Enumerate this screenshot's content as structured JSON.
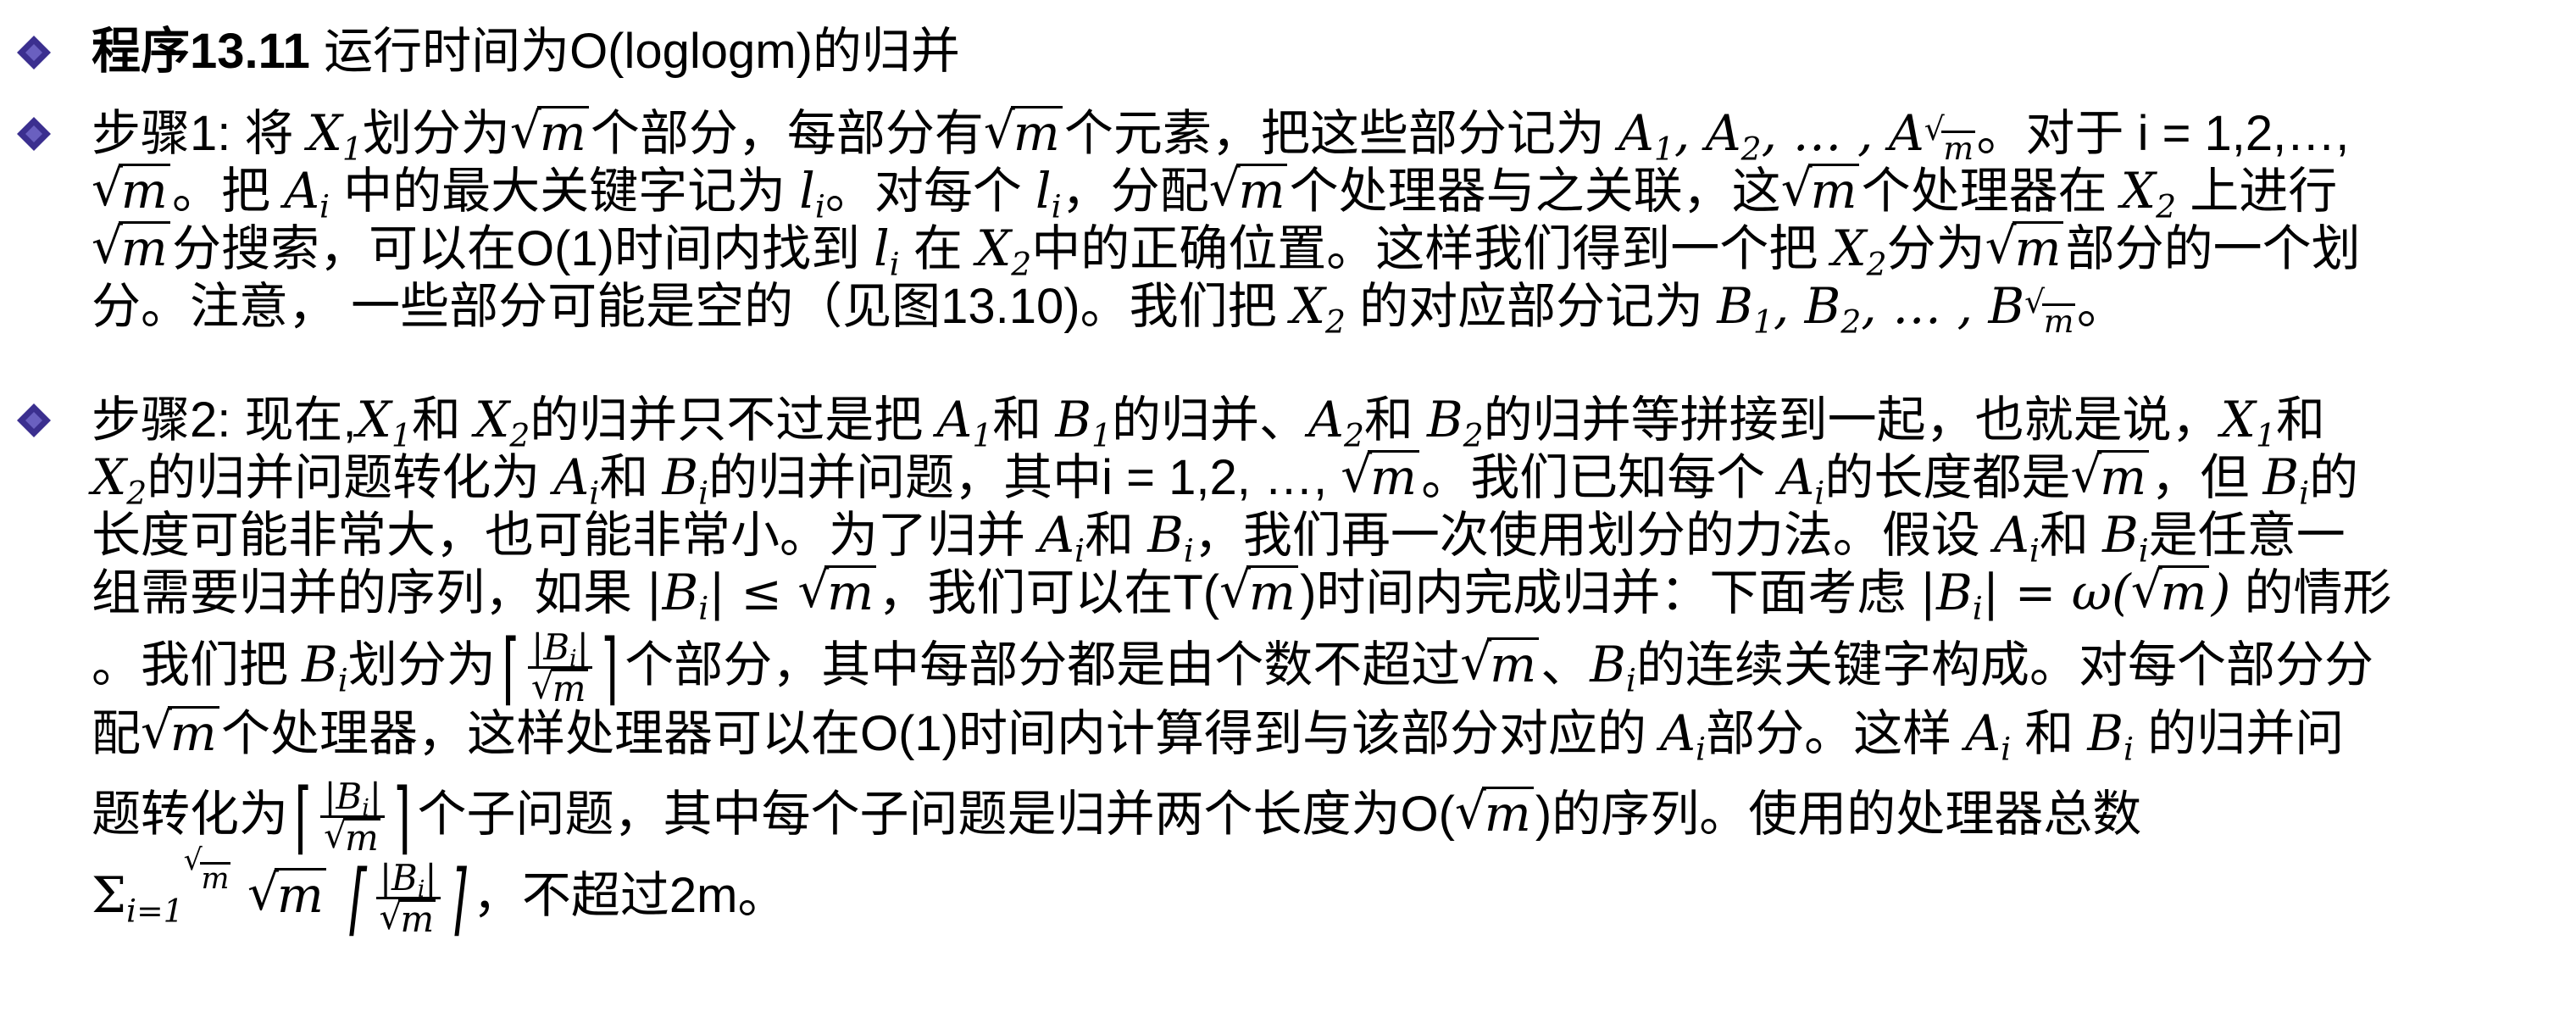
{
  "heading": {
    "label_bold": "程序13.11",
    "label_rest": " 运行时间为O(loglogm)的归并"
  },
  "step1": {
    "l1_a": "步骤1: 将 ",
    "l1_b": "划分为",
    "l1_c": "个部分，每部分有",
    "l1_d": "个元素，把这些部分记为 ",
    "l1_e": "。对于 i = 1,2,…,",
    "l2_a": "。把 ",
    "l2_b": " 中的最大关键字记为 ",
    "l2_c": "。对每个 ",
    "l2_d": "，分配",
    "l2_e": "个处理器与之关联，这",
    "l2_f": "个处理器在 ",
    "l2_g": " 上进行",
    "l3_a": "分搜索，可以在O(1)时间内找到 ",
    "l3_b": " 在 ",
    "l3_c": "中的正确位置。这样我们得到一个把 ",
    "l3_d": "分为",
    "l3_e": "部分的一个划",
    "l4_a": "分。注意， 一些部分可能是空的（见图13.10)。我们把 ",
    "l4_b": " 的对应部分记为 ",
    "l4_c": "。"
  },
  "step2": {
    "l1_a": "步骤2: 现在,",
    "l1_b": "和 ",
    "l1_c": "的归并只不过是把 ",
    "l1_d": "和 ",
    "l1_e": "的归并、",
    "l1_f": "和 ",
    "l1_g": "的归并等拼接到一起，也就是说，",
    "l1_h": "和",
    "l2_a": "的归并问题转化为 ",
    "l2_b": "和 ",
    "l2_c": "的归并问题，其中i = 1,2, …, ",
    "l2_d": "。我们已知每个 ",
    "l2_e": "的长度都是",
    "l2_f": "，但 ",
    "l2_g": "的",
    "l3_a": "长度可能非常大，也可能非常小。为了归并 ",
    "l3_b": "和 ",
    "l3_c": "，我们再一次使用划分的力法。假设 ",
    "l3_d": "和 ",
    "l3_e": "是任意一",
    "l4_a": "组需要归并的序列，如果 ",
    "l4_b": "，我们可以在T(",
    "l4_c": ")时间内完成归并：下面考虑 ",
    "l4_d": " 的情形",
    "l5_a": "。我们把 ",
    "l5_b": "划分为",
    "l5_c": "个部分，其中每部分都是由个数不超过",
    "l5_d": "、",
    "l5_e": "的连续关键字构成。对每个部分分",
    "l6_a": "配",
    "l6_b": "个处理器，这样处理器可以在O(1)时间内计算得到与该部分对应的 ",
    "l6_c": "部分。这样 ",
    "l6_d": " 和 ",
    "l6_e": " 的归并问",
    "l7_a": "题转化为",
    "l7_b": "个子问题，其中每个子问题是归并两个长度为O(",
    "l7_c": ")的序列。使用的处理器总数",
    "l8_a": "，不超过2m。"
  },
  "math": {
    "X1": "X",
    "X2": "X",
    "A": "A",
    "B": "B",
    "l": "l",
    "m": "m",
    "i": "i",
    "one": "1",
    "two": "2",
    "ell": "…",
    "sqrt_m": "m",
    "abs_Bi_le": "|B",
    "le": "| ≤ ",
    "eq_omega": "| = ω(",
    "sum_sym": "Σ",
    "sum_lower": "i=1",
    "omega_close": ")"
  },
  "colors": {
    "bullet_fill": "#3b2f8f",
    "bullet_outline": "#ffffff"
  }
}
